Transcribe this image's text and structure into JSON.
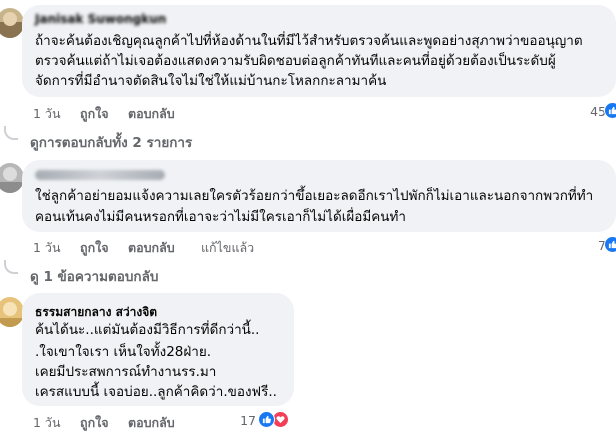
{
  "comments": [
    {
      "author": "Janisak Suwongkun",
      "body": [
        "ถ้าจะค้นต้องเชิญคุณลูกค้าไปที่ห้องด้านในที่มีไว้สำหรับตรวจค้นและพูดอย่างสุภาพว่าขออนุญาต",
        "ตรวจค้นแต่ถ้าไม่เจอต้องแสดงความรับผิดชอบต่อลูกค้าทันทีและคนที่อยู่ด้วยต้องเป็นระดับผู้",
        "จัดการที่มีอำนาจตัดสินใจไม่ใช่ให้แม่บ้านกะโหลกกะลามาค้น"
      ],
      "time": "1 วัน",
      "like_label": "ถูกใจ",
      "reply_label": "ตอบกลับ",
      "reaction_count": "45",
      "replies_label": "ดูการตอบกลับทั้ง 2 รายการ"
    },
    {
      "author": "",
      "body": [
        "ใช่ลูกค้าอย่ายอมแจ้งความเลยใครตัวร้อยกว่าขึ้อเยอะลดอีกเราไปพักก็ไม่เอาและนอกจากพวกที่ทำ",
        "คอนเท้นคงไม่มีคนหรอกที่เอาจะว่าไม่มีใครเอาก็ไม่ได้เผื่อมีคนทำ"
      ],
      "time": "1 วัน",
      "like_label": "ถูกใจ",
      "reply_label": "ตอบกลับ",
      "edited_label": "แก้ไขแล้ว",
      "reaction_count": "7",
      "replies_label": "ดู 1 ข้อความตอบกลับ"
    },
    {
      "author": "ธรรมสายกลาง สว่างจิต",
      "body": [
        "ค้นได้นะ..แต่มันต้องมีวิธีการที่ดีกว่านี้..",
        ".ใจเขาใจเรา เห็นใจทั้ง28ฝ่าย.",
        "เคยมีประสพการณ์ทำงานรร.มา",
        "เครสแบบนี้ เจอบ่อย..ลูกค้าคิดว่า.ของฟรี.."
      ],
      "time": "1 วัน",
      "like_label": "ถูกใจ",
      "reply_label": "ตอบกลับ",
      "reaction_count": "17"
    }
  ],
  "icons": {
    "like": "like-reaction-icon",
    "love": "love-reaction-icon"
  },
  "colors": {
    "bubble": "#f0f2f5",
    "meta": "#65676b",
    "like": "#1877f2",
    "love": "#f33e58"
  }
}
